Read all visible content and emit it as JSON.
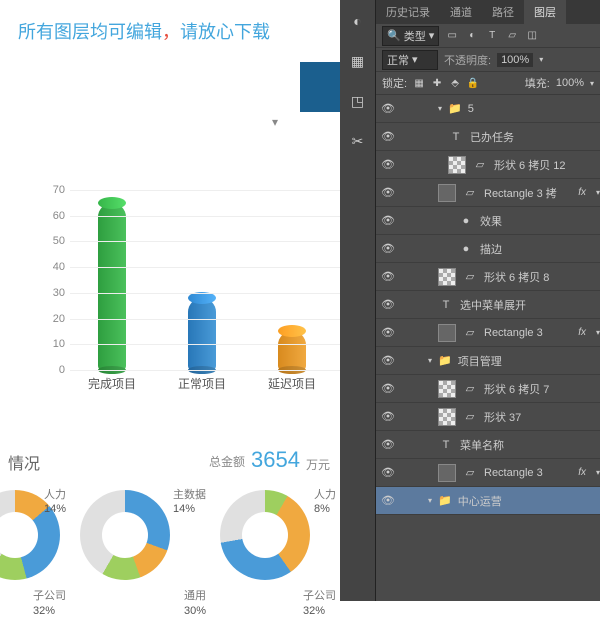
{
  "banner": {
    "text1": "所有图层均可编辑",
    "text2": "，",
    "text3": "请放心下载"
  },
  "chart_data": {
    "type": "bar",
    "categories": [
      "完成项目",
      "正常项目",
      "延迟项目"
    ],
    "values": [
      65,
      28,
      15
    ],
    "ylim": [
      0,
      70
    ],
    "yticks": [
      0,
      10,
      20,
      30,
      40,
      50,
      60,
      70
    ],
    "title": "",
    "xlabel": "",
    "ylabel": ""
  },
  "section2": {
    "title": "情况",
    "total_label": "总金额",
    "total_value": "3654",
    "total_unit": "万元"
  },
  "donuts": [
    {
      "top": {
        "name": "人力",
        "pct": "14%"
      },
      "bottom": {
        "name": "子公司",
        "pct": "32%"
      }
    },
    {
      "top": {
        "name": "主数据",
        "pct": "14%"
      },
      "bottom": {
        "name": "通用",
        "pct": "30%"
      }
    },
    {
      "top": {
        "name": "人力",
        "pct": "8%"
      },
      "bottom": {
        "name": "子公司",
        "pct": "32%"
      }
    }
  ],
  "ps": {
    "tabs": [
      "历史记录",
      "通道",
      "路径",
      "图层"
    ],
    "type_label": "类型",
    "blend": "正常",
    "opacity_label": "不透明度:",
    "opacity": "100%",
    "lock_label": "锁定:",
    "fill_label": "填充:",
    "fill": "100%",
    "layers": [
      {
        "eye": true,
        "indent": 3,
        "kind": "folder",
        "open": true,
        "name": "5"
      },
      {
        "eye": true,
        "indent": 4,
        "kind": "text",
        "name": "已办任务"
      },
      {
        "eye": true,
        "indent": 4,
        "kind": "shape",
        "thumb": "checker",
        "name": "形状 6 拷贝 12"
      },
      {
        "eye": true,
        "indent": 3,
        "kind": "shape",
        "thumb": "rect",
        "name": "Rectangle 3 拷",
        "fx": true
      },
      {
        "eye": true,
        "indent": 5,
        "kind": "fx-head",
        "name": "效果"
      },
      {
        "eye": true,
        "indent": 5,
        "kind": "fx-item",
        "name": "描边"
      },
      {
        "eye": true,
        "indent": 3,
        "kind": "shape",
        "thumb": "checker",
        "name": "形状 6 拷贝 8"
      },
      {
        "eye": true,
        "indent": 3,
        "kind": "text",
        "name": "选中菜单展开"
      },
      {
        "eye": true,
        "indent": 3,
        "kind": "shape",
        "thumb": "rect",
        "name": "Rectangle 3",
        "fx": true
      },
      {
        "eye": true,
        "indent": 2,
        "kind": "folder",
        "open": true,
        "name": "项目管理"
      },
      {
        "eye": true,
        "indent": 3,
        "kind": "shape",
        "thumb": "checker",
        "name": "形状 6 拷贝 7"
      },
      {
        "eye": true,
        "indent": 3,
        "kind": "shape",
        "thumb": "checker",
        "name": "形状 37"
      },
      {
        "eye": true,
        "indent": 3,
        "kind": "text",
        "name": "菜单名称"
      },
      {
        "eye": true,
        "indent": 3,
        "kind": "shape",
        "thumb": "rect",
        "name": "Rectangle 3",
        "fx": true
      },
      {
        "eye": true,
        "indent": 2,
        "kind": "folder",
        "open": true,
        "name": "中心运营",
        "sel": true
      }
    ]
  }
}
